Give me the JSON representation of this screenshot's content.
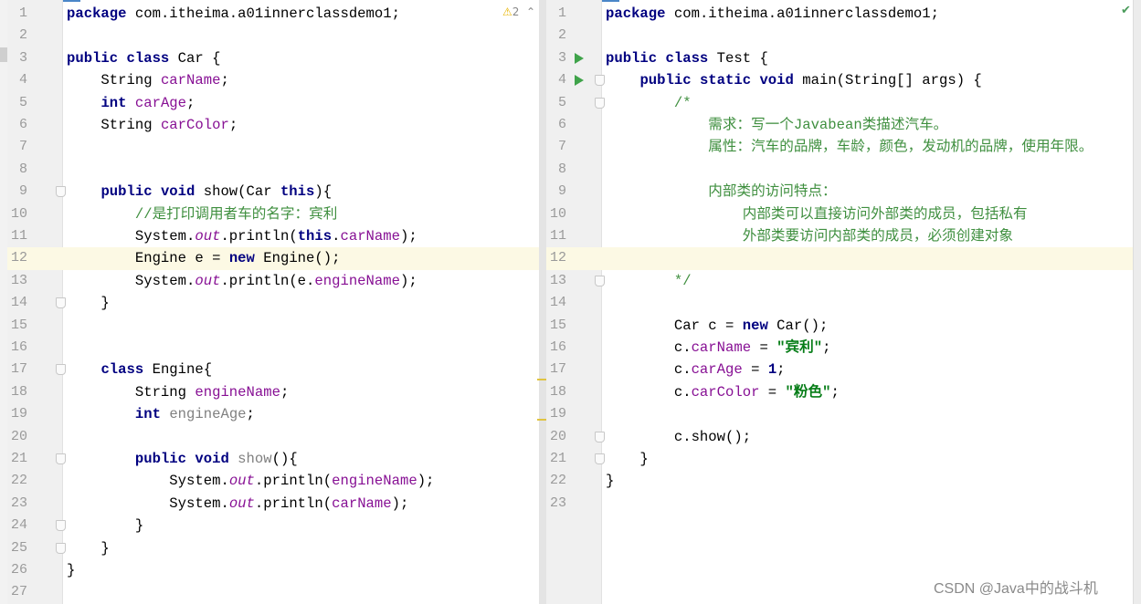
{
  "left_editor": {
    "warnings_count": "2",
    "warning_icon": "warning-triangle-icon",
    "current_line": 12,
    "lines": [
      [
        [
          "package",
          "kw"
        ],
        [
          " com.itheima.a01innerclassdemo1;",
          ""
        ]
      ],
      [],
      [
        [
          "public class",
          "kw"
        ],
        [
          " Car {",
          ""
        ]
      ],
      [
        [
          "    String ",
          ""
        ],
        [
          "carName",
          "fld"
        ],
        [
          ";",
          ""
        ]
      ],
      [
        [
          "    ",
          ""
        ],
        [
          "int",
          "kw"
        ],
        [
          " ",
          ""
        ],
        [
          "carAge",
          "fld"
        ],
        [
          ";",
          ""
        ]
      ],
      [
        [
          "    String ",
          ""
        ],
        [
          "carColor",
          "fld"
        ],
        [
          ";",
          ""
        ]
      ],
      [],
      [],
      [
        [
          "    ",
          ""
        ],
        [
          "public void",
          "kw"
        ],
        [
          " show(Car ",
          ""
        ],
        [
          "this",
          "kw"
        ],
        [
          "){",
          ""
        ]
      ],
      [
        [
          "        //是打印调用者车的名字：宾利",
          "cmt"
        ]
      ],
      [
        [
          "        System.",
          ""
        ],
        [
          "out",
          "stat"
        ],
        [
          ".println(",
          ""
        ],
        [
          "this",
          "kw"
        ],
        [
          ".",
          ""
        ],
        [
          "carName",
          "fld"
        ],
        [
          ");",
          ""
        ]
      ],
      [
        [
          "        Engine e = ",
          ""
        ],
        [
          "new",
          "kw"
        ],
        [
          " Engine();",
          ""
        ]
      ],
      [
        [
          "        System.",
          ""
        ],
        [
          "out",
          "stat"
        ],
        [
          ".println(e.",
          ""
        ],
        [
          "engineName",
          "fld"
        ],
        [
          ");",
          ""
        ]
      ],
      [
        [
          "    }",
          ""
        ]
      ],
      [],
      [],
      [
        [
          "    ",
          ""
        ],
        [
          "class",
          "kw"
        ],
        [
          " Engine{",
          ""
        ]
      ],
      [
        [
          "        String ",
          ""
        ],
        [
          "engineName",
          "fld"
        ],
        [
          ";",
          ""
        ]
      ],
      [
        [
          "        ",
          ""
        ],
        [
          "int",
          "kw"
        ],
        [
          " ",
          ""
        ],
        [
          "engineAge",
          "unused"
        ],
        [
          ";",
          ""
        ]
      ],
      [],
      [
        [
          "        ",
          ""
        ],
        [
          "public void",
          "kw"
        ],
        [
          " ",
          ""
        ],
        [
          "show",
          "unused"
        ],
        [
          "(){",
          ""
        ]
      ],
      [
        [
          "            System.",
          ""
        ],
        [
          "out",
          "stat"
        ],
        [
          ".println(",
          ""
        ],
        [
          "engineName",
          "fld"
        ],
        [
          ");",
          ""
        ]
      ],
      [
        [
          "            System.",
          ""
        ],
        [
          "out",
          "stat"
        ],
        [
          ".println(",
          ""
        ],
        [
          "carName",
          "fld"
        ],
        [
          ");",
          ""
        ]
      ],
      [
        [
          "        }",
          ""
        ]
      ],
      [
        [
          "    }",
          ""
        ]
      ],
      [
        [
          "}",
          ""
        ]
      ],
      []
    ],
    "fold_lines": [
      9,
      14,
      17,
      21,
      24,
      25
    ]
  },
  "right_editor": {
    "status_icon": "check-icon",
    "current_line": 12,
    "run_lines": [
      3,
      4
    ],
    "fold_lines": [
      4,
      5,
      13,
      20,
      21
    ],
    "lines": [
      [
        [
          "package",
          "kw"
        ],
        [
          " com.itheima.a01innerclassdemo1;",
          ""
        ]
      ],
      [],
      [
        [
          "public class",
          "kw"
        ],
        [
          " Test {",
          ""
        ]
      ],
      [
        [
          "    ",
          ""
        ],
        [
          "public static void",
          "kw"
        ],
        [
          " main(String[] args) {",
          ""
        ]
      ],
      [
        [
          "        /*",
          "cmt"
        ]
      ],
      [
        [
          "            需求：写一个Javabean类描述汽车。",
          "cmt"
        ]
      ],
      [
        [
          "            属性：汽车的品牌，车龄，颜色，发动机的品牌，使用年限。",
          "cmt"
        ]
      ],
      [],
      [
        [
          "            内部类的访问特点：",
          "cmt"
        ]
      ],
      [
        [
          "                内部类可以直接访问外部类的成员，包括私有",
          "cmt"
        ]
      ],
      [
        [
          "                外部类要访问内部类的成员，必须创建对象",
          "cmt"
        ]
      ],
      [],
      [
        [
          "        */",
          "cmt"
        ]
      ],
      [],
      [
        [
          "        Car c = ",
          ""
        ],
        [
          "new",
          "kw"
        ],
        [
          " Car();",
          ""
        ]
      ],
      [
        [
          "        c.",
          ""
        ],
        [
          "carName",
          "fld"
        ],
        [
          " = ",
          ""
        ],
        [
          "\"宾利\"",
          "str"
        ],
        [
          ";",
          ""
        ]
      ],
      [
        [
          "        c.",
          ""
        ],
        [
          "carAge",
          "fld"
        ],
        [
          " = ",
          ""
        ],
        [
          "1",
          "kw"
        ],
        [
          ";",
          ""
        ]
      ],
      [
        [
          "        c.",
          ""
        ],
        [
          "carColor",
          "fld"
        ],
        [
          " = ",
          ""
        ],
        [
          "\"粉色\"",
          "str"
        ],
        [
          ";",
          ""
        ]
      ],
      [],
      [
        [
          "        c.show();",
          ""
        ]
      ],
      [
        [
          "    }",
          ""
        ]
      ],
      [
        [
          "}",
          ""
        ]
      ],
      []
    ]
  },
  "watermark": "CSDN @Java中的战斗机",
  "colors": {
    "keyword": "#000080",
    "field": "#871094",
    "comment": "#3f8f3f",
    "string": "#067d17",
    "current_line": "#fcf9e4"
  }
}
